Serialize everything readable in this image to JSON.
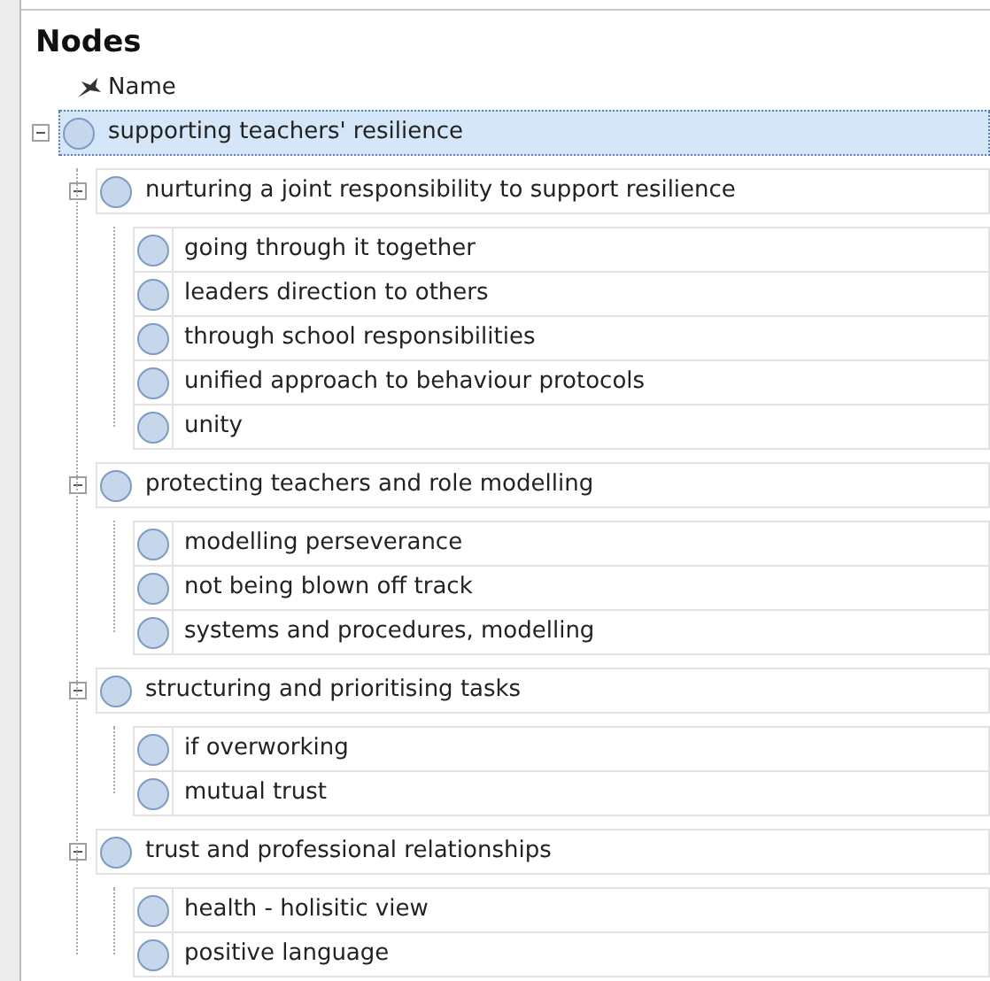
{
  "panel": {
    "title": "Nodes"
  },
  "columns": [
    {
      "label": "Name"
    }
  ],
  "tree": [
    {
      "label": "supporting teachers' resilience",
      "selected": true,
      "expanded": true,
      "children": [
        {
          "label": "nurturing a joint responsibility to support resilience",
          "selected": false,
          "expanded": true,
          "children": [
            {
              "label": "going through it together",
              "selected": false
            },
            {
              "label": "leaders direction to others",
              "selected": false
            },
            {
              "label": "through school responsibilities",
              "selected": false
            },
            {
              "label": "unified approach to behaviour protocols",
              "selected": false
            },
            {
              "label": "unity",
              "selected": false
            }
          ]
        },
        {
          "label": "protecting teachers and role modelling",
          "selected": false,
          "expanded": true,
          "children": [
            {
              "label": "modelling perseverance",
              "selected": false
            },
            {
              "label": "not being blown off track",
              "selected": false
            },
            {
              "label": "systems and procedures, modelling",
              "selected": false
            }
          ]
        },
        {
          "label": "structuring and prioritising tasks",
          "selected": false,
          "expanded": true,
          "children": [
            {
              "label": "if overworking",
              "selected": false
            },
            {
              "label": "mutual trust",
              "selected": false
            }
          ]
        },
        {
          "label": "trust and professional relationships",
          "selected": false,
          "expanded": true,
          "children": [
            {
              "label": "health - holisitic view",
              "selected": false
            },
            {
              "label": "positive language",
              "selected": false
            }
          ]
        }
      ]
    }
  ]
}
